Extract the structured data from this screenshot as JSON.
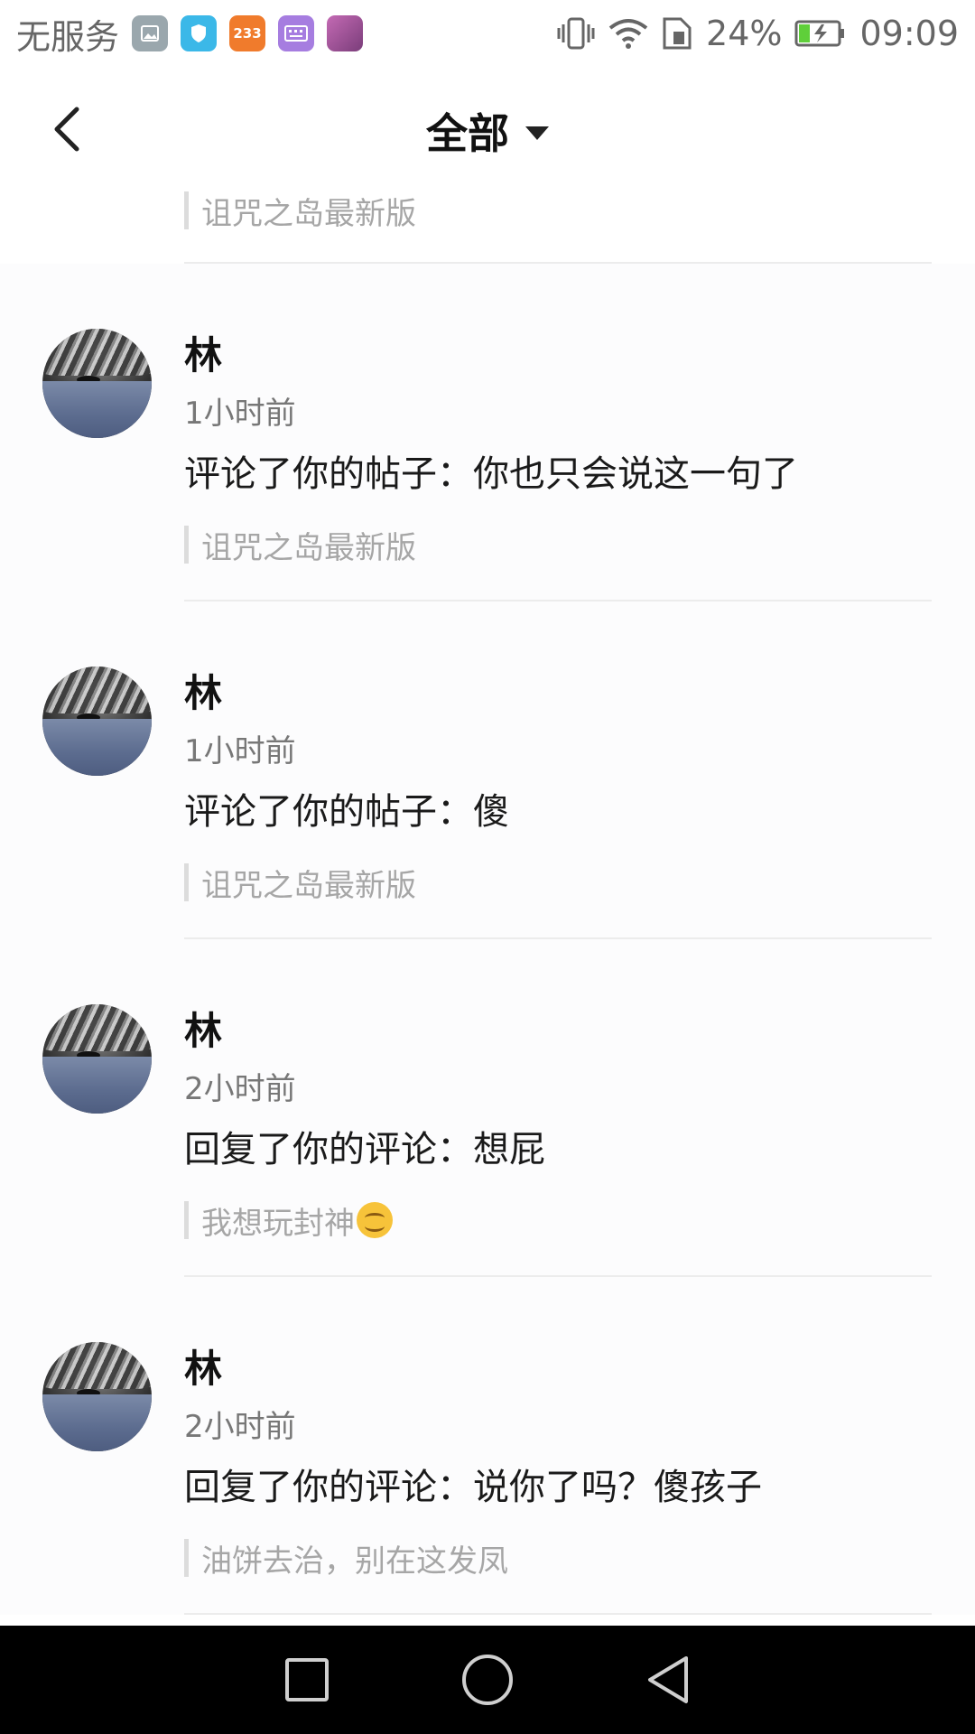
{
  "status_bar": {
    "carrier": "无服务",
    "app_icons": [
      {
        "name": "gallery-icon",
        "color": "#9aa7ad",
        "label": ""
      },
      {
        "name": "shield-icon",
        "color": "#3bb8e8",
        "label": ""
      },
      {
        "name": "app-233-icon",
        "color": "#f07b2c",
        "label": "233"
      },
      {
        "name": "keyboard-icon",
        "color": "#a67de0",
        "label": ""
      },
      {
        "name": "photo-thumb-icon",
        "color": "#b06aa8",
        "label": ""
      }
    ],
    "battery_percent": "24%",
    "time": "09:09"
  },
  "header": {
    "title": "全部"
  },
  "partial_item": {
    "quote": "诅咒之岛最新版"
  },
  "notifications": [
    {
      "name": "林",
      "time": "1小时前",
      "message": "评论了你的帖子：你也只会说这一句了",
      "quote": "诅咒之岛最新版"
    },
    {
      "name": "林",
      "time": "1小时前",
      "message": "评论了你的帖子：傻",
      "quote": "诅咒之岛最新版"
    },
    {
      "name": "林",
      "time": "2小时前",
      "message": "回复了你的评论：想屁",
      "quote": "我想玩封神"
    },
    {
      "name": "林",
      "time": "2小时前",
      "message": "回复了你的评论：说你了吗？傻孩子",
      "quote": "油饼去治，别在这发凤"
    }
  ],
  "colors": {
    "accent_battery": "#5fcf3a",
    "nav_bar": "#000000"
  }
}
